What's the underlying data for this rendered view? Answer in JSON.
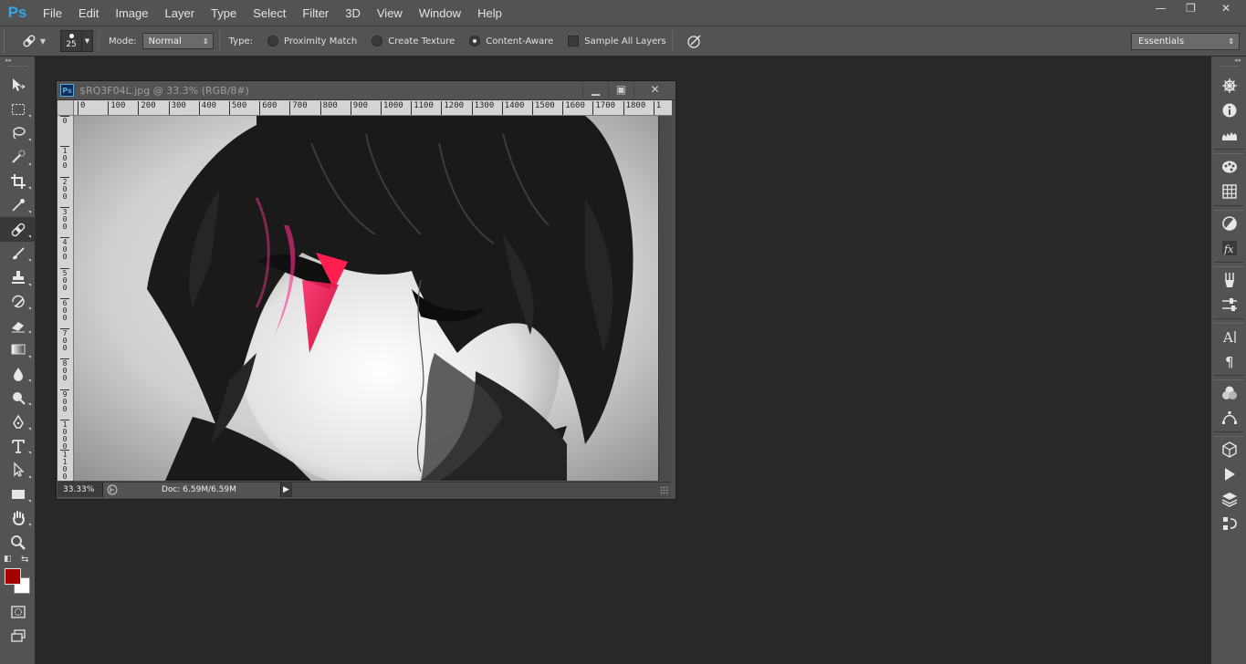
{
  "app": {
    "logo": "Ps"
  },
  "menu": [
    "File",
    "Edit",
    "Image",
    "Layer",
    "Type",
    "Select",
    "Filter",
    "3D",
    "View",
    "Window",
    "Help"
  ],
  "window_controls": {
    "minimize": "—",
    "restore": "❐",
    "close": "✕"
  },
  "options": {
    "brush_size": "25",
    "mode_label": "Mode:",
    "mode_value": "Normal",
    "type_label": "Type:",
    "radio_proximity": "Proximity Match",
    "radio_texture": "Create Texture",
    "radio_content_aware": "Content-Aware",
    "selected_type": "Content-Aware",
    "sample_all_layers": "Sample All Layers",
    "sample_all_layers_checked": false,
    "workspace": "Essentials"
  },
  "document": {
    "title": "$RQ3F04L.jpg @ 33.3% (RGB/8#)",
    "ps_badge": "Ps",
    "zoom": "33.33%",
    "doc_info": "Doc: 6.59M/6.59M",
    "ruler_top": [
      "0",
      "100",
      "200",
      "300",
      "400",
      "500",
      "600",
      "700",
      "800",
      "900",
      "1000",
      "1100",
      "1200",
      "1300",
      "1400",
      "1500",
      "1600",
      "1700",
      "1800",
      "1"
    ],
    "ruler_left": [
      "0",
      "1\n0\n0",
      "2\n0\n0",
      "3\n0\n0",
      "4\n0\n0",
      "5\n0\n0",
      "6\n0\n0",
      "7\n0\n0",
      "8\n0\n0",
      "9\n0\n0",
      "1\n0\n0\n0",
      "1\n1\n0\n0"
    ]
  },
  "colors": {
    "foreground": "#a40000",
    "background": "#ffffff",
    "ui_panel": "#535353",
    "workspace_bg": "#282828"
  },
  "tools": [
    "move-icon",
    "marquee-icon",
    "lasso-icon",
    "quick-select-icon",
    "crop-icon",
    "eyedropper-icon",
    "spot-healing-icon",
    "brush-icon",
    "clone-stamp-icon",
    "history-brush-icon",
    "eraser-icon",
    "gradient-icon",
    "blur-icon",
    "dodge-icon",
    "pen-icon",
    "type-icon",
    "path-select-icon",
    "rectangle-icon",
    "hand-icon",
    "zoom-icon"
  ],
  "right_panel": [
    "navigator-icon",
    "info-icon",
    "histogram-icon",
    "color-icon",
    "swatches-icon",
    "adjustments-icon",
    "styles-icon",
    "brush-presets-icon",
    "tool-presets-icon",
    "character-icon",
    "paragraph-icon",
    "channels-icon",
    "paths-icon",
    "3d-icon",
    "actions-icon",
    "layers-icon",
    "history-icon"
  ]
}
